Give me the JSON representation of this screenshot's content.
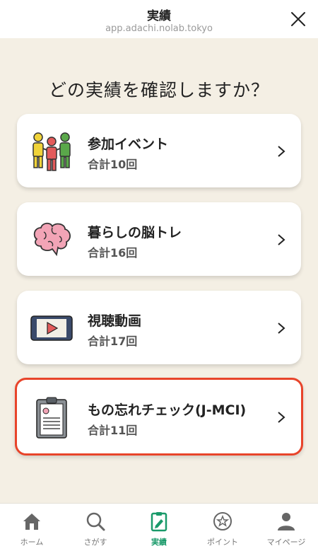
{
  "header": {
    "title": "実績",
    "url": "app.adachi.nolab.tokyo"
  },
  "question": "どの実績を確認しますか？",
  "cards": [
    {
      "title": "参加イベント",
      "count": "合計10回",
      "icon": "people-icon"
    },
    {
      "title": "暮らしの脳トレ",
      "count": "合計16回",
      "icon": "brain-icon"
    },
    {
      "title": "視聴動画",
      "count": "合計17回",
      "icon": "video-play-icon"
    },
    {
      "title": "もの忘れチェック(J-MCI)",
      "count": "合計11回",
      "icon": "clipboard-check-icon"
    }
  ],
  "tabs": [
    {
      "label": "ホーム",
      "icon": "home-icon"
    },
    {
      "label": "さがす",
      "icon": "search-icon"
    },
    {
      "label": "実績",
      "icon": "achievement-icon",
      "active": true
    },
    {
      "label": "ポイント",
      "icon": "star-coin-icon"
    },
    {
      "label": "マイページ",
      "icon": "person-icon"
    }
  ],
  "colors": {
    "accent": "#1a9a6a",
    "selected_border": "#e8442a",
    "background": "#f4efe4"
  }
}
